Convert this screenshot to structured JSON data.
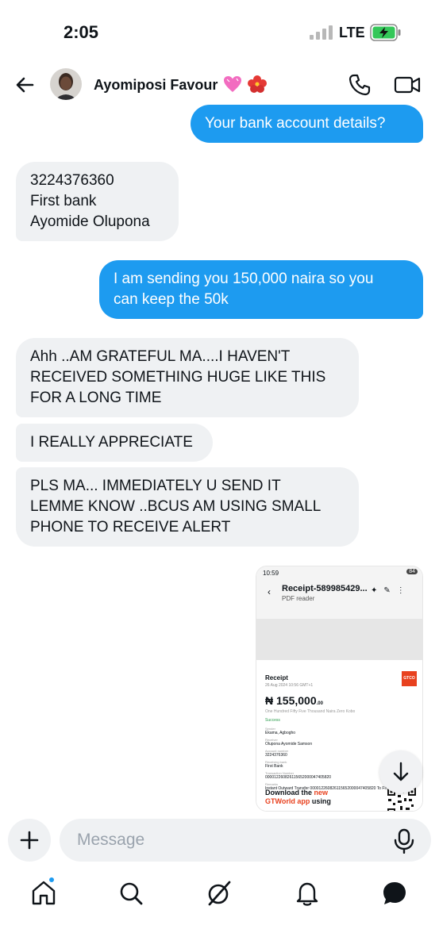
{
  "status_bar": {
    "time": "2:05",
    "network": "LTE"
  },
  "header": {
    "contact_name": "Ayomiposi Favour"
  },
  "messages": [
    {
      "direction": "out",
      "text": "Your bank account details?"
    },
    {
      "direction": "in",
      "text": "3224376360\nFirst bank\nAyomide Olupona"
    },
    {
      "direction": "out",
      "text": "I am sending you 150,000 naira so you\ncan keep the 50k"
    },
    {
      "direction": "in",
      "text": "Ahh ..AM GRATEFUL MA....I HAVEN'T\nRECEIVED SOMETHING HUGE LIKE THIS\nFOR A  LONG TIME"
    },
    {
      "direction": "in",
      "text": "I REALLY APPRECIATE"
    },
    {
      "direction": "in",
      "text": "PLS MA... IMMEDIATELY U SEND IT\nLEMME KNOW ..BCUS AM USING SMALL\nPHONE TO RECEIVE ALERT"
    }
  ],
  "receipt": {
    "time": "10:59",
    "system_badge": "84",
    "title": "Receipt-589985429...",
    "subtitle": "PDF reader",
    "label": "Receipt",
    "date": "26 Aug 2024 10:56 GMT+1",
    "bank_logo": "GTCO",
    "amount": "₦ 155,000",
    "amount_cents": ".00",
    "amount_words": "One Hundred Fifty Five Thousand Naira Zero Kobo",
    "status": "Success",
    "fields": [
      {
        "label": "Sender",
        "value": "Ekama, Agbogho"
      },
      {
        "label": "Receiver",
        "value": "Olupona Ayomide Samson"
      },
      {
        "label": "Account number",
        "value": "3224376360"
      },
      {
        "label": "Receiving bank",
        "value": "First Bank"
      },
      {
        "label": "Transaction Number",
        "value": "000012260826115652000047405820"
      },
      {
        "label": "Remarks",
        "value": "Instant Outward Transfer 000012260826115652000047405820 To First Bank/Olup"
      }
    ],
    "download_prefix": "Download the ",
    "download_new": "new",
    "download_app": "GTWorld app",
    "download_suffix": " using"
  },
  "composer": {
    "placeholder": "Message"
  },
  "colors": {
    "accent": "#1d9bf0",
    "incoming_bubble": "#eff1f3",
    "text": "#0f1419"
  },
  "icons": [
    "back-arrow-icon",
    "phone-icon",
    "video-icon",
    "plus-icon",
    "mic-icon",
    "home-icon",
    "search-icon",
    "grok-icon",
    "bell-icon",
    "messages-icon",
    "arrow-down-icon"
  ]
}
